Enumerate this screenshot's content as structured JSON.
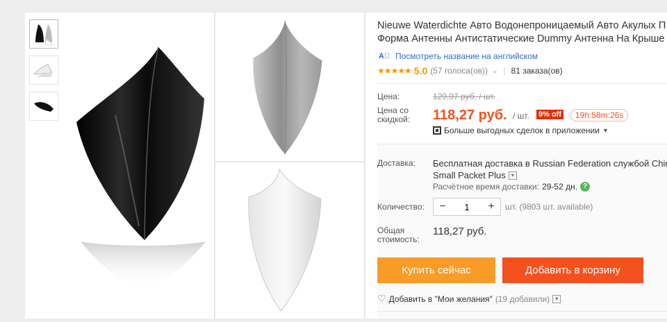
{
  "product": {
    "title_line1": "Nieuwe Waterdichte Авто Водонепроницаемый Авто Акулых П",
    "title_line2": "Форма Антенны Антистатические Dummy Антенна На Крыше",
    "translate_link": "Посмотреть название на английском",
    "rating": {
      "stars": "★★★★★",
      "score": "5.0",
      "votes": "(57 голоса(ов))",
      "orders": "81 заказа(ов)"
    }
  },
  "price": {
    "price_label": "Цена:",
    "old_price": "129,97 руб. / шт.",
    "discount_label_line1": "Цена со",
    "discount_label_line2": "скидкой:",
    "new_price": "118,27 руб.",
    "per_unit": "/ шт.",
    "discount_badge": "9% off",
    "timer": "19h:58m:26s",
    "app_deals": "Больше выгодных сделок в приложении"
  },
  "shipping": {
    "label": "Доставка:",
    "text_line1": "Бесплатная доставка в Russian Federation службой China P",
    "text_line2": "Small Packet Plus",
    "eta_label": "Расчётное время доставки:",
    "eta_value": "29-52 дн."
  },
  "quantity": {
    "label": "Количество:",
    "value": "1",
    "minus": "−",
    "plus": "+",
    "unit": "шт. (9803 шт. available)"
  },
  "total": {
    "label_line1": "Общая",
    "label_line2": "стоимость:",
    "value": "118,27 руб."
  },
  "actions": {
    "buy_now": "Купить сейчас",
    "add_to_cart": "Добавить в корзину",
    "wishlist": "Добавить в \"Мои желания\"",
    "wishlist_count": "(19 добавили)"
  },
  "colors": {
    "accent_orange": "#f5511e",
    "buy_button": "#f89b27",
    "star": "#f39800",
    "link_blue": "#2e6bd2",
    "discount_red": "#e62e04"
  },
  "icons": {
    "translate": "translate-icon",
    "qr": "qr-code-icon",
    "help": "help-icon",
    "heart": "heart-icon",
    "dropdown": "chevron-down-icon"
  }
}
